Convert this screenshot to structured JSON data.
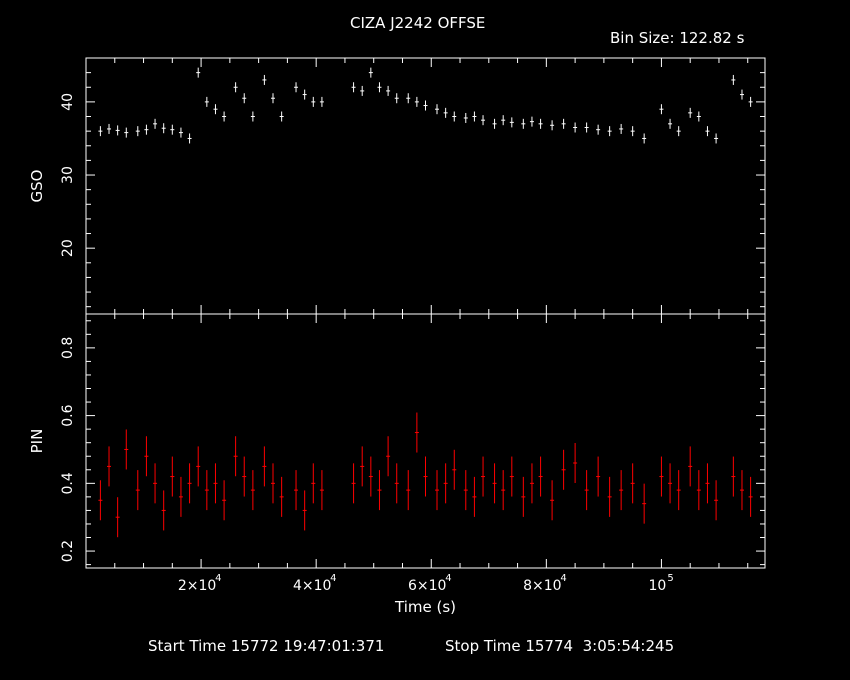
{
  "header": {
    "title": "CIZA J2242 OFFSE",
    "bin_size": "Bin Size: 122.82 s"
  },
  "footer": {
    "start_time": "Start Time 15772 19:47:01:371",
    "stop_time": "Stop Time 15774  3:05:54:245"
  },
  "chart_data": [
    {
      "type": "scatter",
      "title": "CIZA J2242 OFFSE",
      "ylabel": "GSO",
      "xlabel": "",
      "xlim": [
        0,
        118000
      ],
      "ylim": [
        11,
        46
      ],
      "yticks": [
        20,
        30,
        40
      ],
      "color": "#ffffff",
      "series": [
        {
          "x": [
            2500,
            4000,
            5500,
            7000,
            9000,
            10500,
            12000,
            13500,
            15000,
            16500,
            18000,
            19500,
            21000,
            22500,
            24000,
            26000,
            27500,
            29000,
            31000,
            32500,
            34000,
            36500,
            38000,
            39500,
            41000,
            46500,
            48000,
            49500,
            51000,
            52500,
            54000,
            56000,
            57500,
            59000,
            61000,
            62500,
            64000,
            66000,
            67500,
            69000,
            71000,
            72500,
            74000,
            76000,
            77500,
            79000,
            81000,
            83000,
            85000,
            87000,
            89000,
            91000,
            93000,
            95000,
            97000,
            100000,
            101500,
            103000,
            105000,
            106500,
            108000,
            109500,
            112500,
            114000,
            115500
          ],
          "y": [
            36,
            36.3,
            36.1,
            35.8,
            36,
            36.2,
            37,
            36.4,
            36.2,
            35.8,
            35,
            44,
            40,
            39,
            38,
            42,
            40.5,
            38,
            43,
            40.5,
            38,
            42,
            41,
            40,
            40,
            42,
            41.5,
            44,
            42,
            41.5,
            40.5,
            40.5,
            40,
            39.5,
            39,
            38.5,
            38,
            37.8,
            38,
            37.5,
            37,
            37.5,
            37.2,
            37,
            37.3,
            37,
            36.8,
            37,
            36.5,
            36.5,
            36.2,
            36,
            36.3,
            36,
            35,
            39,
            37,
            36,
            38.5,
            38,
            36,
            35,
            43,
            41,
            40
          ]
        }
      ]
    },
    {
      "type": "scatter",
      "title": "",
      "ylabel": "PIN",
      "xlabel": "Time (s)",
      "xlim": [
        0,
        118000
      ],
      "ylim": [
        0.15,
        0.9
      ],
      "yticks": [
        0.2,
        0.4,
        0.6,
        0.8
      ],
      "xticks": [
        {
          "value": 20000,
          "label": "2×10",
          "exp": "4"
        },
        {
          "value": 40000,
          "label": "4×10",
          "exp": "4"
        },
        {
          "value": 60000,
          "label": "6×10",
          "exp": "4"
        },
        {
          "value": 80000,
          "label": "8×10",
          "exp": "4"
        },
        {
          "value": 100000,
          "label": "10",
          "exp": "5"
        }
      ],
      "color": "#ff0000",
      "series": [
        {
          "x": [
            2500,
            4000,
            5500,
            7000,
            9000,
            10500,
            12000,
            13500,
            15000,
            16500,
            18000,
            19500,
            21000,
            22500,
            24000,
            26000,
            27500,
            29000,
            31000,
            32500,
            34000,
            36500,
            38000,
            39500,
            41000,
            46500,
            48000,
            49500,
            51000,
            52500,
            54000,
            56000,
            57500,
            59000,
            61000,
            62500,
            64000,
            66000,
            67500,
            69000,
            71000,
            72500,
            74000,
            76000,
            77500,
            79000,
            81000,
            83000,
            85000,
            87000,
            89000,
            91000,
            93000,
            95000,
            97000,
            100000,
            101500,
            103000,
            105000,
            106500,
            108000,
            109500,
            112500,
            114000,
            115500
          ],
          "y": [
            0.35,
            0.45,
            0.3,
            0.5,
            0.38,
            0.48,
            0.4,
            0.32,
            0.42,
            0.36,
            0.4,
            0.45,
            0.38,
            0.4,
            0.35,
            0.48,
            0.42,
            0.38,
            0.45,
            0.4,
            0.36,
            0.38,
            0.32,
            0.4,
            0.38,
            0.4,
            0.45,
            0.42,
            0.38,
            0.48,
            0.4,
            0.38,
            0.55,
            0.42,
            0.38,
            0.4,
            0.44,
            0.38,
            0.36,
            0.42,
            0.4,
            0.38,
            0.42,
            0.36,
            0.4,
            0.42,
            0.35,
            0.44,
            0.46,
            0.38,
            0.42,
            0.36,
            0.38,
            0.4,
            0.34,
            0.42,
            0.4,
            0.38,
            0.45,
            0.38,
            0.4,
            0.35,
            0.42,
            0.38,
            0.36
          ]
        }
      ]
    }
  ]
}
